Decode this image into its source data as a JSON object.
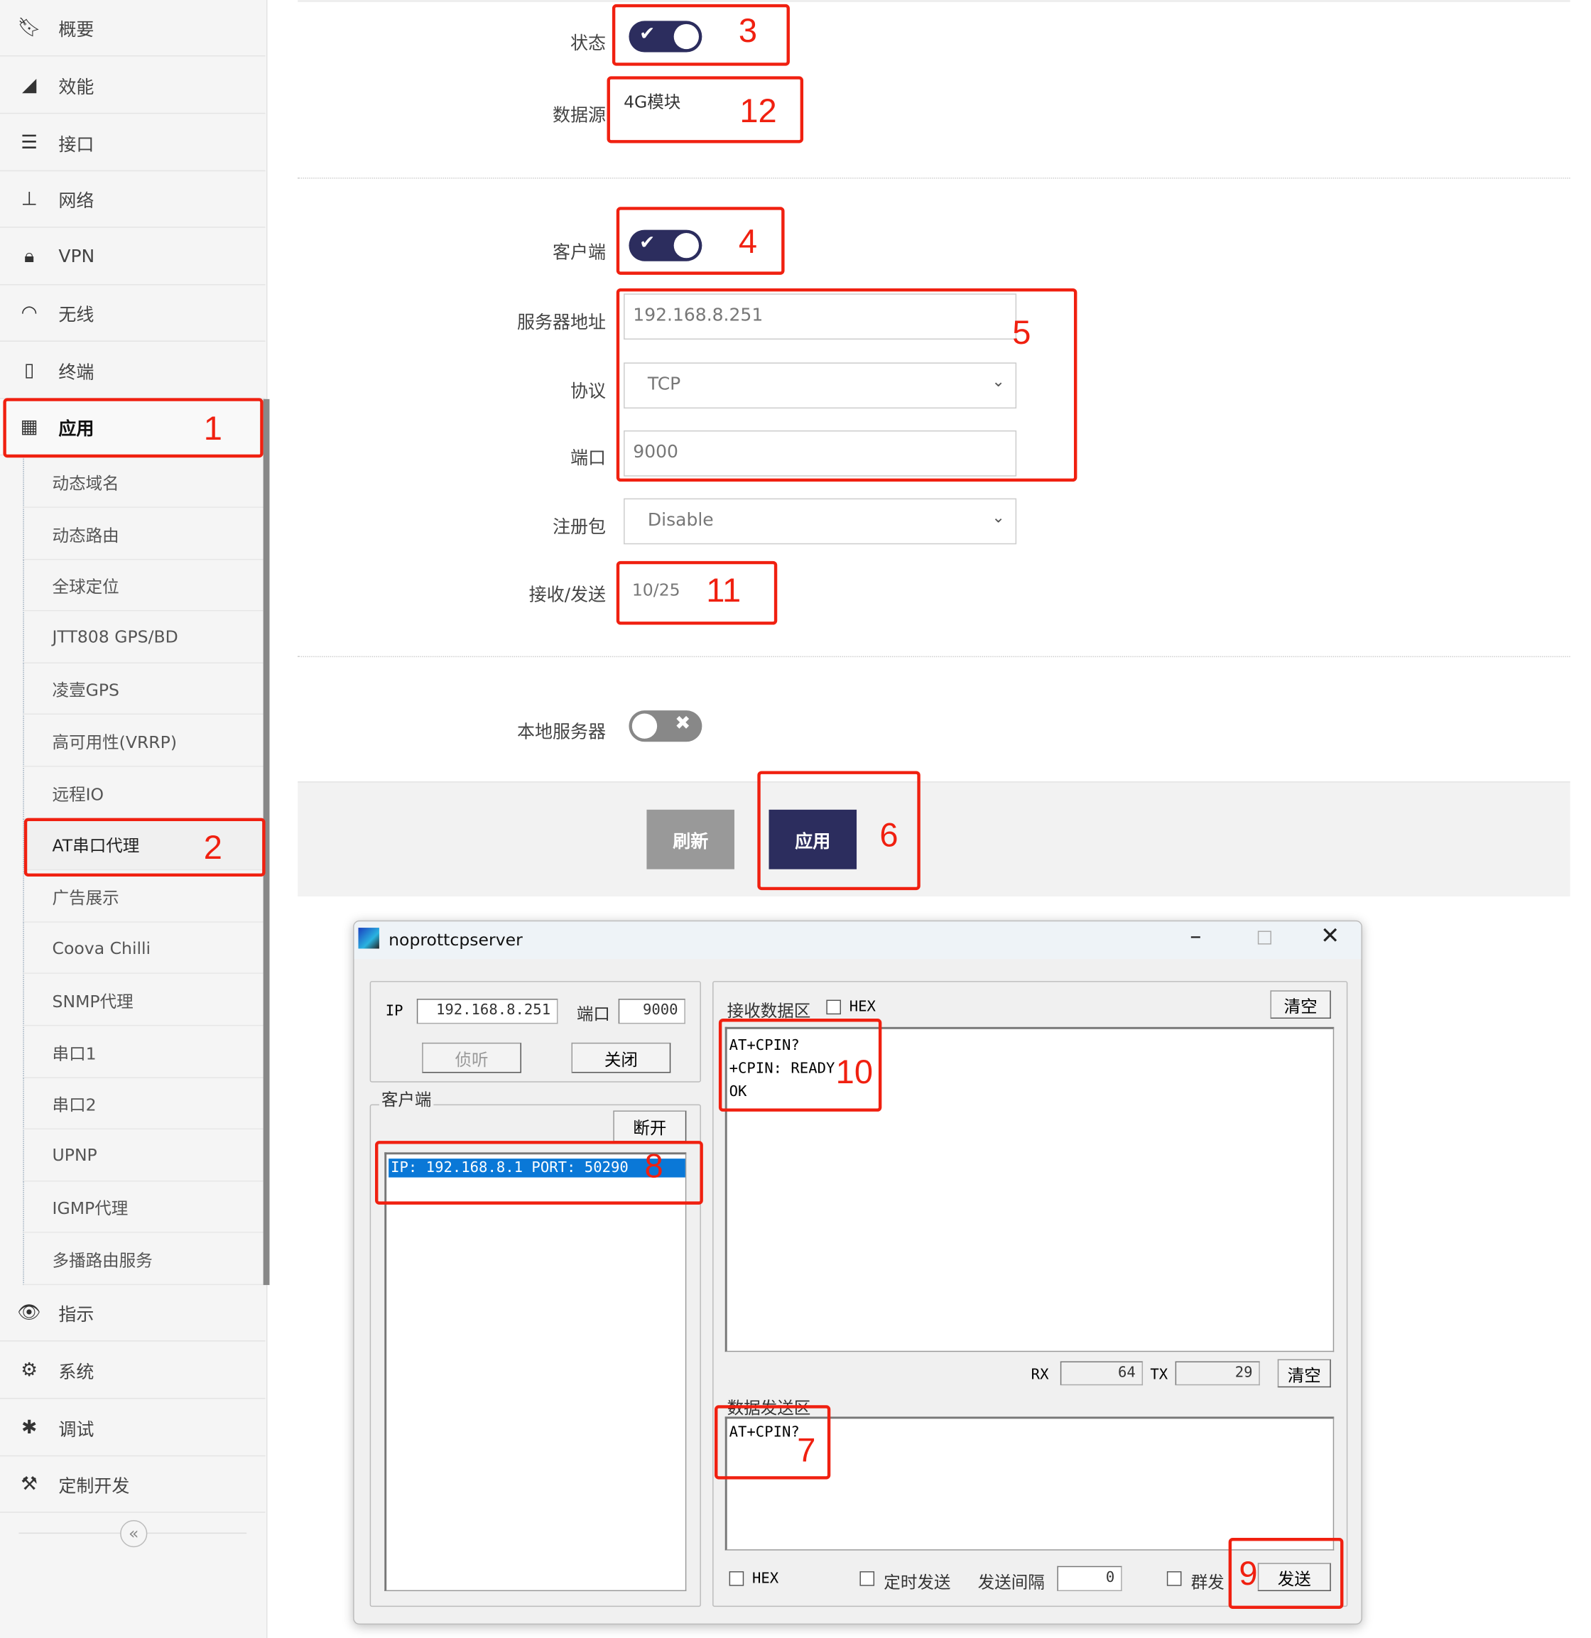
{
  "sidebar": {
    "items": [
      {
        "label": "概要",
        "icon": "bookmark-icon"
      },
      {
        "label": "效能",
        "icon": "area-chart-icon"
      },
      {
        "label": "接口",
        "icon": "list-icon"
      },
      {
        "label": "网络",
        "icon": "sitemap-icon"
      },
      {
        "label": "VPN",
        "icon": "lock-icon"
      },
      {
        "label": "无线",
        "icon": "wifi-icon"
      },
      {
        "label": "终端",
        "icon": "mobile-icon"
      },
      {
        "label": "应用",
        "icon": "building-icon",
        "active": true
      }
    ],
    "subitems": [
      "动态域名",
      "动态路由",
      "全球定位",
      "JTT808 GPS/BD",
      "凌壹GPS",
      "高可用性(VRRP)",
      "远程IO",
      "AT串口代理",
      "广告展示",
      "Coova Chilli",
      "SNMP代理",
      "串口1",
      "串口2",
      "UPNP",
      "IGMP代理",
      "多播路由服务"
    ],
    "active_subitem": "AT串口代理",
    "bottom_items": [
      {
        "label": "指示",
        "icon": "eye-icon"
      },
      {
        "label": "系统",
        "icon": "gears-icon"
      },
      {
        "label": "调试",
        "icon": "bug-icon"
      },
      {
        "label": "定制开发",
        "icon": "gavel-icon"
      }
    ],
    "collapse": "«"
  },
  "form": {
    "status_label": "状态",
    "status_on": true,
    "datasource_label": "数据源",
    "datasource_value": "4G模块",
    "client_label": "客户端",
    "client_on": true,
    "server_label": "服务器地址",
    "server_value": "192.168.8.251",
    "protocol_label": "协议",
    "protocol_value": "TCP",
    "port_label": "端口",
    "port_value": "9000",
    "register_label": "注册包",
    "register_value": "Disable",
    "rxtx_label": "接收/发送",
    "rxtx_value": "10/25",
    "local_server_label": "本地服务器",
    "local_server_on": false,
    "refresh_label": "刷新",
    "apply_label": "应用"
  },
  "annotations": [
    "1",
    "2",
    "3",
    "4",
    "5",
    "6",
    "7",
    "8",
    "9",
    "10",
    "11",
    "12"
  ],
  "colors": {
    "accent": "#2c2d5e",
    "annotation": "#f02010",
    "selection": "#0a78d7"
  },
  "window": {
    "title": "noprottcpserver",
    "ip_label": "IP",
    "ip_value": "192.168.8.251",
    "port_label": "端口",
    "port_value": "9000",
    "listen_label": "侦听",
    "close_label": "关闭",
    "client_group": "客户端",
    "disconnect_label": "断开",
    "clients": [
      "IP: 192.168.8.1 PORT: 50290"
    ],
    "recv_label": "接收数据区",
    "hex_label": "HEX",
    "clear_label": "清空",
    "recv_lines": [
      "AT+CPIN?",
      "+CPIN: READY",
      "OK"
    ],
    "rx_label": "RX",
    "rx_value": "64",
    "tx_label": "TX",
    "tx_value": "29",
    "send_label": "数据发送区",
    "send_text": "AT+CPIN?",
    "timed_label": "定时发送",
    "interval_label": "发送间隔",
    "interval_value": "0",
    "broadcast_label": "群发",
    "send_button": "发送"
  }
}
